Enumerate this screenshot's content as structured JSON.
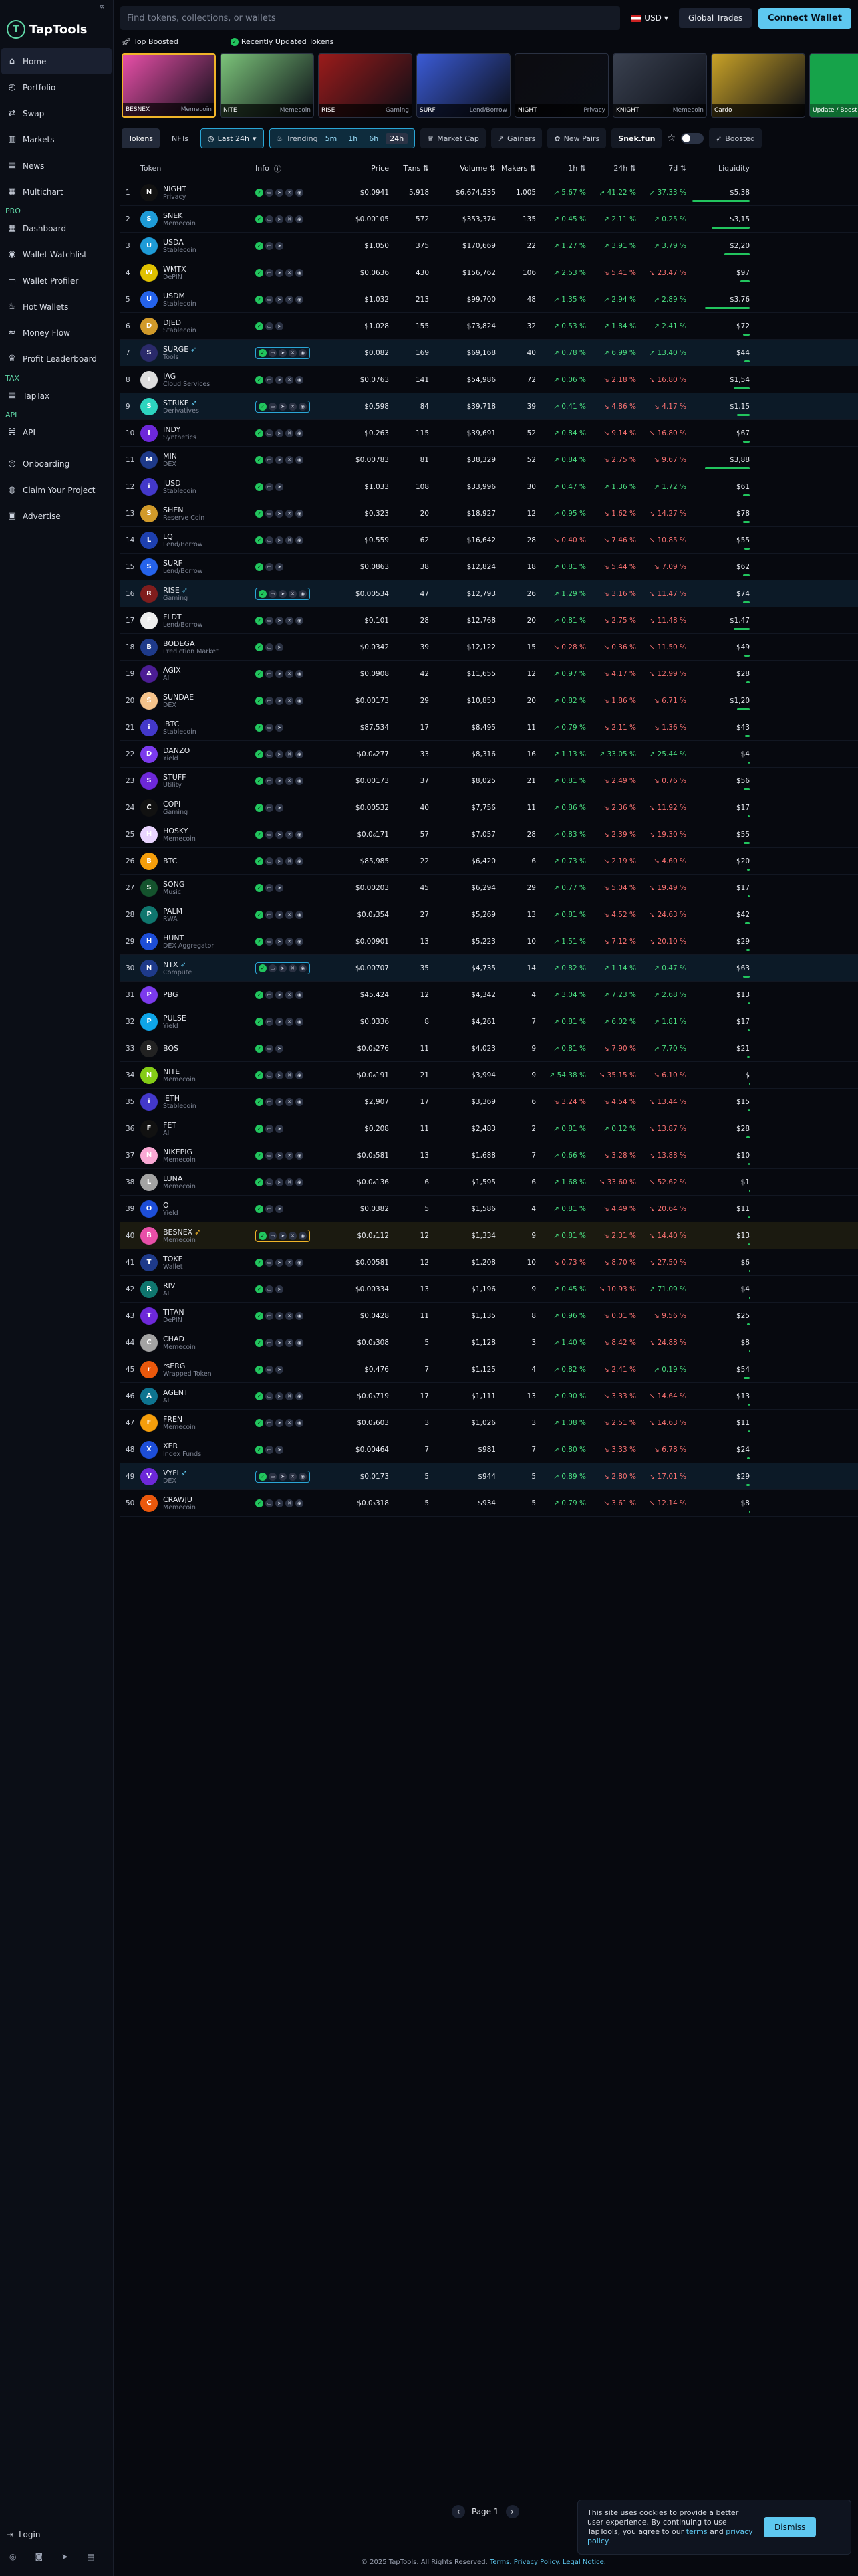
{
  "app": {
    "name": "TapTools",
    "collapse": "«"
  },
  "nav": [
    {
      "label": "Home",
      "icon": "home-icon",
      "glyph": "⌂",
      "active": true
    },
    {
      "label": "Portfolio",
      "icon": "portfolio-icon",
      "glyph": "◴"
    },
    {
      "label": "Swap",
      "icon": "swap-icon",
      "glyph": "⇄"
    },
    {
      "label": "Markets",
      "icon": "markets-icon",
      "glyph": "▥"
    },
    {
      "label": "News",
      "icon": "news-icon",
      "glyph": "▤"
    },
    {
      "label": "Multichart",
      "icon": "multichart-icon",
      "glyph": "▦"
    }
  ],
  "nav_pro_label": "PRO",
  "nav_pro": [
    {
      "label": "Dashboard",
      "icon": "dashboard-icon",
      "glyph": "▦"
    },
    {
      "label": "Wallet Watchlist",
      "icon": "eye-icon",
      "glyph": "◉"
    },
    {
      "label": "Wallet Profiler",
      "icon": "wallet-icon",
      "glyph": "▭"
    },
    {
      "label": "Hot Wallets",
      "icon": "fire-icon",
      "glyph": "♨"
    },
    {
      "label": "Money Flow",
      "icon": "flow-icon",
      "glyph": "≈"
    },
    {
      "label": "Profit Leaderboard",
      "icon": "trophy-icon",
      "glyph": "♛"
    }
  ],
  "nav_tax_label": "TAX",
  "nav_tax": [
    {
      "label": "TapTax",
      "icon": "tax-icon",
      "glyph": "▤"
    }
  ],
  "nav_api_label": "API",
  "nav_api": [
    {
      "label": "API",
      "icon": "api-icon",
      "glyph": "⌘"
    }
  ],
  "nav_extra": [
    {
      "label": "Onboarding",
      "icon": "onboarding-icon",
      "glyph": "◎"
    },
    {
      "label": "Claim Your Project",
      "icon": "claim-icon",
      "glyph": "◍"
    },
    {
      "label": "Advertise",
      "icon": "advertise-icon",
      "glyph": "▣"
    }
  ],
  "login_label": "Login",
  "search": {
    "placeholder": "Find tokens, collections, or wallets"
  },
  "currency": "USD",
  "global_trades": "Global Trades",
  "connect_wallet": "Connect Wallet",
  "strip": {
    "top_boosted": "Top Boosted",
    "recently_updated": "Recently Updated Tokens"
  },
  "cards": [
    {
      "name": "BESNEX",
      "sub": "Memecoin",
      "boosted": true,
      "bg": "#e84fa8"
    },
    {
      "name": "NITE",
      "sub": "Memecoin",
      "bg": "#7cc47a"
    },
    {
      "name": "RISE",
      "sub": "Gaming",
      "bg": "#9b1b1b"
    },
    {
      "name": "SURF",
      "sub": "Lend/Borrow",
      "bg": "#3b5bd6"
    },
    {
      "name": "NIGHT",
      "sub": "Privacy",
      "bg": "#0c0c10"
    },
    {
      "name": "KNIGHT",
      "sub": "Memecoin",
      "bg": "#3a4150"
    },
    {
      "name": "Cardo",
      "sub": "",
      "bg": "#c9a227"
    },
    {
      "name": "Update / Boost",
      "sub": "",
      "bg": "#16a34a",
      "update": true
    }
  ],
  "filters": {
    "tokens": "Tokens",
    "nfts": "NFTs",
    "last24": "Last 24h",
    "trending": "Trending",
    "segs": [
      "5m",
      "1h",
      "6h",
      "24h"
    ],
    "market_cap": "Market Cap",
    "gainers": "Gainers",
    "new_pairs": "New Pairs",
    "snek": "Snek.fun",
    "boosted": "Boosted"
  },
  "columns": {
    "token": "Token",
    "info": "Info",
    "price": "Price",
    "txns": "Txns",
    "volume": "Volume",
    "makers": "Makers",
    "h1": "1h",
    "h24": "24h",
    "d7": "7d",
    "liquidity": "Liquidity"
  },
  "rows": [
    {
      "n": "1",
      "name": "NIGHT",
      "sub": "Privacy",
      "color": "#111",
      "price": "$0.0941",
      "txns": "5,918",
      "vol": "$6,674,535",
      "mk": "1,005",
      "h1": "↗ 5.67 %",
      "h24": "↗ 41.22 %",
      "d7": "↗ 37.33 %",
      "liq": "$5,38",
      "liqw": 0.9
    },
    {
      "n": "2",
      "name": "SNEK",
      "sub": "Memecoin",
      "color": "#1e9bd7",
      "price": "$0.00105",
      "txns": "572",
      "vol": "$353,374",
      "mk": "135",
      "h1": "↗ 0.45 %",
      "h24": "↗ 2.11 %",
      "d7": "↗ 0.25 %",
      "liq": "$3,15",
      "liqw": 0.6
    },
    {
      "n": "3",
      "name": "USDA",
      "sub": "Stablecoin",
      "color": "#1e9bd7",
      "price": "$1.050",
      "txns": "375",
      "vol": "$170,669",
      "mk": "22",
      "h1": "↗ 1.27 %",
      "h24": "↗ 3.91 %",
      "d7": "↗ 3.79 %",
      "liq": "$2,20",
      "liqw": 0.4
    },
    {
      "n": "4",
      "name": "WMTX",
      "sub": "DePIN",
      "color": "#e0c100",
      "price": "$0.0636",
      "txns": "430",
      "vol": "$156,762",
      "mk": "106",
      "h1": "↗ 2.53 %",
      "h24": "↘ 5.41 %",
      "d7": "↘ 23.47 %",
      "liq": "$97",
      "liqw": 0.15
    },
    {
      "n": "5",
      "name": "USDM",
      "sub": "Stablecoin",
      "color": "#2563eb",
      "price": "$1.032",
      "txns": "213",
      "vol": "$99,700",
      "mk": "48",
      "h1": "↗ 1.35 %",
      "h24": "↗ 2.94 %",
      "d7": "↗ 2.89 %",
      "liq": "$3,76",
      "liqw": 0.7
    },
    {
      "n": "6",
      "name": "DJED",
      "sub": "Stablecoin",
      "color": "#d19a2a",
      "price": "$1.028",
      "txns": "155",
      "vol": "$73,824",
      "mk": "32",
      "h1": "↗ 0.53 %",
      "h24": "↗ 1.84 %",
      "d7": "↗ 2.41 %",
      "liq": "$72",
      "liqw": 0.1
    },
    {
      "n": "7",
      "name": "SURGE",
      "sub": "Tools",
      "color": "#2a2a6a",
      "price": "$0.082",
      "txns": "169",
      "vol": "$69,168",
      "mk": "40",
      "h1": "↗ 0.78 %",
      "h24": "↗ 6.99 %",
      "d7": "↗ 13.40 %",
      "liq": "$44",
      "liqw": 0.08,
      "hl": "blue"
    },
    {
      "n": "8",
      "name": "IAG",
      "sub": "Cloud Services",
      "color": "#ddd",
      "price": "$0.0763",
      "txns": "141",
      "vol": "$54,986",
      "mk": "72",
      "h1": "↗ 0.06 %",
      "h24": "↘ 2.18 %",
      "d7": "↘ 16.80 %",
      "liq": "$1,54",
      "liqw": 0.25
    },
    {
      "n": "9",
      "name": "STRIKE",
      "sub": "Derivatives",
      "color": "#2dd4bf",
      "price": "$0.598",
      "txns": "84",
      "vol": "$39,718",
      "mk": "39",
      "h1": "↗ 0.41 %",
      "h24": "↘ 4.86 %",
      "d7": "↘ 4.17 %",
      "liq": "$1,15",
      "liqw": 0.2,
      "hl": "blue"
    },
    {
      "n": "10",
      "name": "INDY",
      "sub": "Synthetics",
      "color": "#6d28d9",
      "price": "$0.263",
      "txns": "115",
      "vol": "$39,691",
      "mk": "52",
      "h1": "↗ 0.84 %",
      "h24": "↘ 9.14 %",
      "d7": "↘ 16.80 %",
      "liq": "$67",
      "liqw": 0.1
    },
    {
      "n": "11",
      "name": "MIN",
      "sub": "DEX",
      "color": "#1e3a8a",
      "price": "$0.00783",
      "txns": "81",
      "vol": "$38,329",
      "mk": "52",
      "h1": "↗ 0.84 %",
      "h24": "↘ 2.75 %",
      "d7": "↘ 9.67 %",
      "liq": "$3,88",
      "liqw": 0.7
    },
    {
      "n": "12",
      "name": "iUSD",
      "sub": "Stablecoin",
      "color": "#4338ca",
      "price": "$1.033",
      "txns": "108",
      "vol": "$33,996",
      "mk": "30",
      "h1": "↗ 0.47 %",
      "h24": "↗ 1.36 %",
      "d7": "↗ 1.72 %",
      "liq": "$61",
      "liqw": 0.1
    },
    {
      "n": "13",
      "name": "SHEN",
      "sub": "Reserve Coin",
      "color": "#d19a2a",
      "price": "$0.323",
      "txns": "20",
      "vol": "$18,927",
      "mk": "12",
      "h1": "↗ 0.95 %",
      "h24": "↘ 1.62 %",
      "d7": "↘ 14.27 %",
      "liq": "$78",
      "liqw": 0.1
    },
    {
      "n": "14",
      "name": "LQ",
      "sub": "Lend/Borrow",
      "color": "#1e40af",
      "price": "$0.559",
      "txns": "62",
      "vol": "$16,642",
      "mk": "28",
      "h1": "↘ 0.40 %",
      "h24": "↘ 7.46 %",
      "d7": "↘ 10.85 %",
      "liq": "$55",
      "liqw": 0.08
    },
    {
      "n": "15",
      "name": "SURF",
      "sub": "Lend/Borrow",
      "color": "#2563eb",
      "price": "$0.0863",
      "txns": "38",
      "vol": "$12,824",
      "mk": "18",
      "h1": "↗ 0.81 %",
      "h24": "↘ 5.44 %",
      "d7": "↘ 7.09 %",
      "liq": "$62",
      "liqw": 0.1
    },
    {
      "n": "16",
      "name": "RISE",
      "sub": "Gaming",
      "color": "#7f1d1d",
      "price": "$0.00534",
      "txns": "47",
      "vol": "$12,793",
      "mk": "26",
      "h1": "↗ 1.29 %",
      "h24": "↘ 3.16 %",
      "d7": "↘ 11.47 %",
      "liq": "$74",
      "liqw": 0.1,
      "hl": "blue"
    },
    {
      "n": "17",
      "name": "FLDT",
      "sub": "Lend/Borrow",
      "color": "#eee",
      "price": "$0.101",
      "txns": "28",
      "vol": "$12,768",
      "mk": "20",
      "h1": "↗ 0.81 %",
      "h24": "↘ 2.75 %",
      "d7": "↘ 11.48 %",
      "liq": "$1,47",
      "liqw": 0.25
    },
    {
      "n": "18",
      "name": "BODEGA",
      "sub": "Prediction Market",
      "color": "#1e3a8a",
      "price": "$0.0342",
      "txns": "39",
      "vol": "$12,122",
      "mk": "15",
      "h1": "↘ 0.28 %",
      "h24": "↘ 0.36 %",
      "d7": "↘ 11.50 %",
      "liq": "$49",
      "liqw": 0.08
    },
    {
      "n": "19",
      "name": "AGIX",
      "sub": "AI",
      "color": "#4c1d95",
      "price": "$0.0908",
      "txns": "42",
      "vol": "$11,655",
      "mk": "12",
      "h1": "↗ 0.97 %",
      "h24": "↘ 4.17 %",
      "d7": "↘ 12.99 %",
      "liq": "$28",
      "liqw": 0.05
    },
    {
      "n": "20",
      "name": "SUNDAE",
      "sub": "DEX",
      "color": "#f5c28a",
      "price": "$0.00173",
      "txns": "29",
      "vol": "$10,853",
      "mk": "20",
      "h1": "↗ 0.82 %",
      "h24": "↘ 1.86 %",
      "d7": "↘ 6.71 %",
      "liq": "$1,20",
      "liqw": 0.2
    },
    {
      "n": "21",
      "name": "iBTC",
      "sub": "Stablecoin",
      "color": "#4338ca",
      "price": "$87,534",
      "txns": "17",
      "vol": "$8,495",
      "mk": "11",
      "h1": "↗ 0.79 %",
      "h24": "↘ 2.11 %",
      "d7": "↘ 1.36 %",
      "liq": "$43",
      "liqw": 0.07
    },
    {
      "n": "22",
      "name": "DANZO",
      "sub": "Yield",
      "color": "#7c3aed",
      "price": "$0.0₆277",
      "txns": "33",
      "vol": "$8,316",
      "mk": "16",
      "h1": "↗ 1.13 %",
      "h24": "↗ 33.05 %",
      "d7": "↗ 25.44 %",
      "liq": "$4",
      "liqw": 0.02
    },
    {
      "n": "23",
      "name": "STUFF",
      "sub": "Utility",
      "color": "#6d28d9",
      "price": "$0.00173",
      "txns": "37",
      "vol": "$8,025",
      "mk": "21",
      "h1": "↗ 0.81 %",
      "h24": "↘ 2.49 %",
      "d7": "↘ 0.76 %",
      "liq": "$56",
      "liqw": 0.09
    },
    {
      "n": "24",
      "name": "COPI",
      "sub": "Gaming",
      "color": "#111",
      "price": "$0.00532",
      "txns": "40",
      "vol": "$7,756",
      "mk": "11",
      "h1": "↗ 0.86 %",
      "h24": "↘ 2.36 %",
      "d7": "↘ 11.92 %",
      "liq": "$17",
      "liqw": 0.03
    },
    {
      "n": "25",
      "name": "HOSKY",
      "sub": "Memecoin",
      "color": "#e9d5ff",
      "price": "$0.0₆171",
      "txns": "57",
      "vol": "$7,057",
      "mk": "28",
      "h1": "↗ 0.83 %",
      "h24": "↘ 2.39 %",
      "d7": "↘ 19.30 %",
      "liq": "$55",
      "liqw": 0.09
    },
    {
      "n": "26",
      "name": "BTC",
      "sub": "",
      "color": "#f59e0b",
      "price": "$85,985",
      "txns": "22",
      "vol": "$6,420",
      "mk": "6",
      "h1": "↗ 0.73 %",
      "h24": "↘ 2.19 %",
      "d7": "↘ 4.60 %",
      "liq": "$20",
      "liqw": 0.04
    },
    {
      "n": "27",
      "name": "SONG",
      "sub": "Music",
      "color": "#14532d",
      "price": "$0.00203",
      "txns": "45",
      "vol": "$6,294",
      "mk": "29",
      "h1": "↗ 0.77 %",
      "h24": "↘ 5.04 %",
      "d7": "↘ 19.49 %",
      "liq": "$17",
      "liqw": 0.03
    },
    {
      "n": "28",
      "name": "PALM",
      "sub": "RWA",
      "color": "#0f766e",
      "price": "$0.0₃354",
      "txns": "27",
      "vol": "$5,269",
      "mk": "13",
      "h1": "↗ 0.81 %",
      "h24": "↘ 4.52 %",
      "d7": "↘ 24.63 %",
      "liq": "$42",
      "liqw": 0.07
    },
    {
      "n": "29",
      "name": "HUNT",
      "sub": "DEX Aggregator",
      "color": "#1d4ed8",
      "price": "$0.00901",
      "txns": "13",
      "vol": "$5,223",
      "mk": "10",
      "h1": "↗ 1.51 %",
      "h24": "↘ 7.12 %",
      "d7": "↘ 20.10 %",
      "liq": "$29",
      "liqw": 0.05
    },
    {
      "n": "30",
      "name": "NTX",
      "sub": "Compute",
      "color": "#1e3a8a",
      "price": "$0.00707",
      "txns": "35",
      "vol": "$4,735",
      "mk": "14",
      "h1": "↗ 0.82 %",
      "h24": "↗ 1.14 %",
      "d7": "↗ 0.47 %",
      "liq": "$63",
      "liqw": 0.1,
      "hl": "blue"
    },
    {
      "n": "31",
      "name": "PBG",
      "sub": "",
      "color": "#7c3aed",
      "price": "$45.424",
      "txns": "12",
      "vol": "$4,342",
      "mk": "4",
      "h1": "↗ 3.04 %",
      "h24": "↗ 7.23 %",
      "d7": "↗ 2.68 %",
      "liq": "$13",
      "liqw": 0.02
    },
    {
      "n": "32",
      "name": "PULSE",
      "sub": "Yield",
      "color": "#0ea5e9",
      "price": "$0.0336",
      "txns": "8",
      "vol": "$4,261",
      "mk": "7",
      "h1": "↗ 0.81 %",
      "h24": "↗ 6.02 %",
      "d7": "↗ 1.81 %",
      "liq": "$17",
      "liqw": 0.03
    },
    {
      "n": "33",
      "name": "BOS",
      "sub": "",
      "color": "#222",
      "price": "$0.0₃276",
      "txns": "11",
      "vol": "$4,023",
      "mk": "9",
      "h1": "↗ 0.81 %",
      "h24": "↘ 7.90 %",
      "d7": "↗ 7.70 %",
      "liq": "$21",
      "liqw": 0.04
    },
    {
      "n": "34",
      "name": "NITE",
      "sub": "Memecoin",
      "color": "#84cc16",
      "price": "$0.0₆191",
      "txns": "21",
      "vol": "$3,994",
      "mk": "9",
      "h1": "↗ 54.38 %",
      "h24": "↘ 35.15 %",
      "d7": "↘ 6.10 %",
      "liq": "$",
      "liqw": 0.01
    },
    {
      "n": "35",
      "name": "iETH",
      "sub": "Stablecoin",
      "color": "#4338ca",
      "price": "$2,907",
      "txns": "17",
      "vol": "$3,369",
      "mk": "6",
      "h1": "↘ 3.24 %",
      "h24": "↘ 4.54 %",
      "d7": "↘ 13.44 %",
      "liq": "$15",
      "liqw": 0.02
    },
    {
      "n": "36",
      "name": "FET",
      "sub": "AI",
      "color": "#111",
      "price": "$0.208",
      "txns": "11",
      "vol": "$2,483",
      "mk": "2",
      "h1": "↗ 0.81 %",
      "h24": "↗ 0.12 %",
      "d7": "↘ 13.87 %",
      "liq": "$28",
      "liqw": 0.05
    },
    {
      "n": "37",
      "name": "NIKEPIG",
      "sub": "Memecoin",
      "color": "#f9a8d4",
      "price": "$0.0₃581",
      "txns": "13",
      "vol": "$1,688",
      "mk": "7",
      "h1": "↗ 0.66 %",
      "h24": "↘ 3.28 %",
      "d7": "↘ 13.88 %",
      "liq": "$10",
      "liqw": 0.02
    },
    {
      "n": "38",
      "name": "LUNA",
      "sub": "Memecoin",
      "color": "#a3a3a3",
      "price": "$0.0₆136",
      "txns": "6",
      "vol": "$1,595",
      "mk": "6",
      "h1": "↗ 1.68 %",
      "h24": "↘ 33.60 %",
      "d7": "↘ 52.62 %",
      "liq": "$1",
      "liqw": 0.01
    },
    {
      "n": "39",
      "name": "O",
      "sub": "Yield",
      "color": "#1d4ed8",
      "price": "$0.0382",
      "txns": "5",
      "vol": "$1,586",
      "mk": "4",
      "h1": "↗ 0.81 %",
      "h24": "↘ 4.49 %",
      "d7": "↘ 20.64 %",
      "liq": "$11",
      "liqw": 0.02
    },
    {
      "n": "40",
      "name": "BESNEX",
      "sub": "Memecoin",
      "color": "#e84fa8",
      "price": "$0.0₃112",
      "txns": "12",
      "vol": "$1,334",
      "mk": "9",
      "h1": "↗ 0.81 %",
      "h24": "↘ 2.31 %",
      "d7": "↘ 14.40 %",
      "liq": "$13",
      "liqw": 0.02,
      "hl": "gold"
    },
    {
      "n": "41",
      "name": "TOKE",
      "sub": "Wallet",
      "color": "#1e3a8a",
      "price": "$0.00581",
      "txns": "12",
      "vol": "$1,208",
      "mk": "10",
      "h1": "↘ 0.73 %",
      "h24": "↘ 8.70 %",
      "d7": "↘ 27.50 %",
      "liq": "$6",
      "liqw": 0.01
    },
    {
      "n": "42",
      "name": "RIV",
      "sub": "AI",
      "color": "#0f766e",
      "price": "$0.00334",
      "txns": "13",
      "vol": "$1,196",
      "mk": "9",
      "h1": "↗ 0.45 %",
      "h24": "↘ 10.93 %",
      "d7": "↗ 71.09 %",
      "liq": "$4",
      "liqw": 0.01
    },
    {
      "n": "43",
      "name": "TITAN",
      "sub": "DePIN",
      "color": "#6d28d9",
      "price": "$0.0428",
      "txns": "11",
      "vol": "$1,135",
      "mk": "8",
      "h1": "↗ 0.96 %",
      "h24": "↘ 0.01 %",
      "d7": "↘ 9.56 %",
      "liq": "$25",
      "liqw": 0.04
    },
    {
      "n": "44",
      "name": "CHAD",
      "sub": "Memecoin",
      "color": "#a3a3a3",
      "price": "$0.0₃308",
      "txns": "5",
      "vol": "$1,128",
      "mk": "3",
      "h1": "↗ 1.40 %",
      "h24": "↘ 8.42 %",
      "d7": "↘ 24.88 %",
      "liq": "$8",
      "liqw": 0.01
    },
    {
      "n": "45",
      "name": "rsERG",
      "sub": "Wrapped Token",
      "color": "#ea580c",
      "price": "$0.476",
      "txns": "7",
      "vol": "$1,125",
      "mk": "4",
      "h1": "↗ 0.82 %",
      "h24": "↘ 2.41 %",
      "d7": "↗ 0.19 %",
      "liq": "$54",
      "liqw": 0.09
    },
    {
      "n": "46",
      "name": "AGENT",
      "sub": "AI",
      "color": "#0e7490",
      "price": "$0.0₃719",
      "txns": "17",
      "vol": "$1,111",
      "mk": "13",
      "h1": "↗ 0.90 %",
      "h24": "↘ 3.33 %",
      "d7": "↘ 14.64 %",
      "liq": "$13",
      "liqw": 0.02
    },
    {
      "n": "47",
      "name": "FREN",
      "sub": "Memecoin",
      "color": "#f59e0b",
      "price": "$0.0₃603",
      "txns": "3",
      "vol": "$1,026",
      "mk": "3",
      "h1": "↗ 1.08 %",
      "h24": "↘ 2.51 %",
      "d7": "↘ 14.63 %",
      "liq": "$11",
      "liqw": 0.02
    },
    {
      "n": "48",
      "name": "XER",
      "sub": "Index Funds",
      "color": "#1d4ed8",
      "price": "$0.00464",
      "txns": "7",
      "vol": "$981",
      "mk": "7",
      "h1": "↗ 0.80 %",
      "h24": "↘ 3.33 %",
      "d7": "↘ 6.78 %",
      "liq": "$24",
      "liqw": 0.04
    },
    {
      "n": "49",
      "name": "VYFI",
      "sub": "DEX",
      "color": "#6d28d9",
      "price": "$0.0173",
      "txns": "5",
      "vol": "$944",
      "mk": "5",
      "h1": "↗ 0.89 %",
      "h24": "↘ 2.80 %",
      "d7": "↘ 17.01 %",
      "liq": "$29",
      "liqw": 0.05,
      "hl": "blue"
    },
    {
      "n": "50",
      "name": "CRAWJU",
      "sub": "Memecoin",
      "color": "#ea580c",
      "price": "$0.0₃318",
      "txns": "5",
      "vol": "$934",
      "mk": "5",
      "h1": "↗ 0.79 %",
      "h24": "↘ 3.61 %",
      "d7": "↘ 12.14 %",
      "liq": "$8",
      "liqw": 0.01
    }
  ],
  "pager": {
    "label": "Page 1"
  },
  "cookie": {
    "text": "This site uses cookies to provide a better user experience. By continuing to use TapTools, you agree to our",
    "terms": "terms",
    "and": "and",
    "privacy": "privacy policy",
    "dismiss": "Dismiss"
  },
  "footer": {
    "text": "© 2025 TapTools. All Rights Reserved.",
    "terms": "Terms.",
    "privacy": "Privacy Policy.",
    "legal": "Legal Notice."
  }
}
